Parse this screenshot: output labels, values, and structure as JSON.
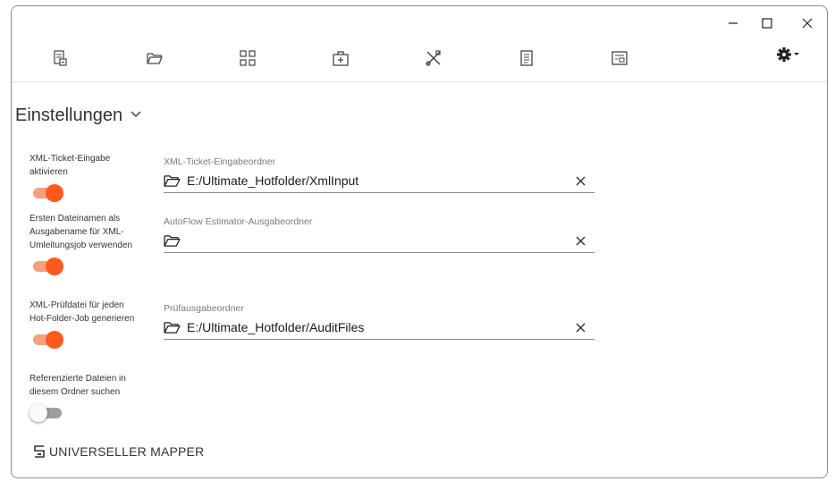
{
  "window": {
    "minimize_icon": "minimize-icon",
    "maximize_icon": "maximize-icon",
    "close_icon": "close-icon"
  },
  "toolbar": {
    "items": [
      {
        "icon": "ticket-icon"
      },
      {
        "icon": "folder-open-icon"
      },
      {
        "icon": "grid-icon"
      },
      {
        "icon": "toolbox-icon"
      },
      {
        "icon": "tools-icon"
      },
      {
        "icon": "document-list-icon"
      },
      {
        "icon": "document-card-icon"
      }
    ],
    "settings_icon": "gear-icon"
  },
  "section": {
    "title": "Einstellungen"
  },
  "options": [
    {
      "label": "XML-Ticket-Eingabe aktivieren",
      "enabled": true
    },
    {
      "label": "Ersten Dateinamen als Ausgabename für XML-Umleitungsjob verwenden",
      "enabled": true
    },
    {
      "label": "XML-Prüfdatei für jeden Hot-Folder-Job generieren",
      "enabled": true
    },
    {
      "label": "Referenzierte Dateien in diesem Ordner suchen",
      "enabled": false
    }
  ],
  "fields": [
    {
      "label": "XML-Ticket-Eingabeordner",
      "value": "E:/Ultimate_Hotfolder/XmlInput"
    },
    {
      "label": "AutoFlow Estimator-Ausgabeordner",
      "value": ""
    },
    {
      "label": "Prüfausgabeordner",
      "value": "E:/Ultimate_Hotfolder/AuditFiles"
    }
  ],
  "mapper": {
    "label": "UNIVERSELLER MAPPER"
  },
  "colors": {
    "accent": "#ff5a1e",
    "accent_track": "#f7a07c",
    "off_track": "#9e9e9e"
  }
}
